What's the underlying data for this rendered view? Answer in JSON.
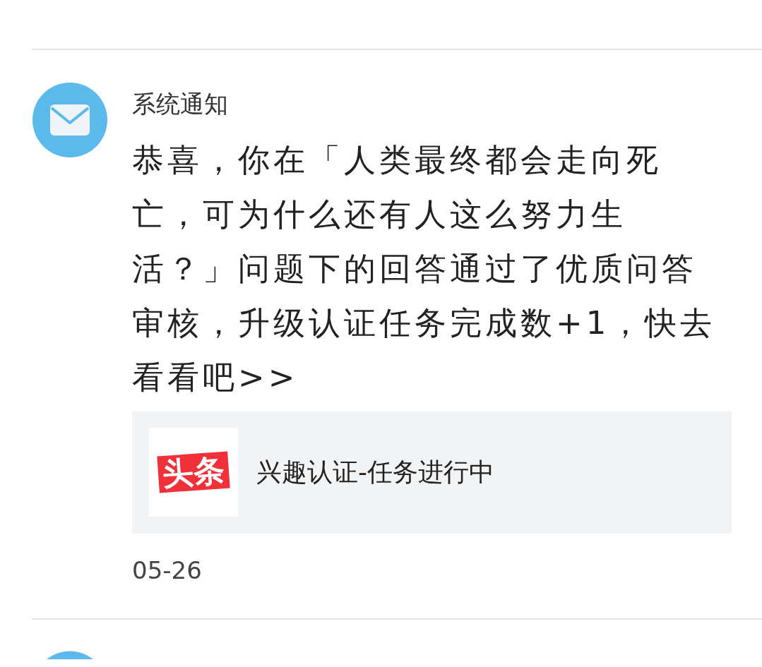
{
  "notification": {
    "sender": "系统通知",
    "message": "恭喜，你在「人类最终都会走向死亡，可为什么还有人这么努力生活？」问题下的回答通过了优质问答审核，升级认证任务完成数+1，快去看看吧>>",
    "card": {
      "logo_text": "头条",
      "title": "兴趣认证-任务进行中"
    },
    "date": "05-26"
  }
}
